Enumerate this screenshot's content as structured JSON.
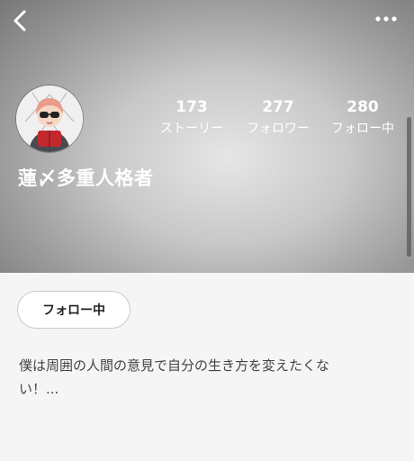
{
  "header": {
    "stats": {
      "stories": {
        "count": "173",
        "label": "ストーリー"
      },
      "followers": {
        "count": "277",
        "label": "フォロワー"
      },
      "following": {
        "count": "280",
        "label": "フォロー中"
      }
    },
    "username": "蓮〆多重人格者",
    "avatar_description": "illustrated character with pink hair, sunglasses, holding a red book"
  },
  "actions": {
    "follow_button_label": "フォロー中"
  },
  "profile": {
    "bio": "僕は周囲の人間の意見で自分の生き方を変えたくない！..."
  },
  "colors": {
    "header_gradient_center": "#e6e6e6",
    "header_gradient_edge": "#777777",
    "content_background": "#f5f5f5",
    "bio_text": "#444444"
  }
}
